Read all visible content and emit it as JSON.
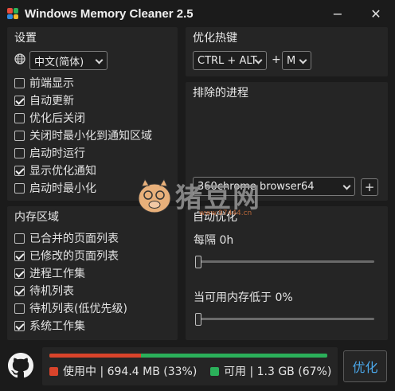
{
  "window": {
    "title": "Windows Memory Cleaner 2.5",
    "controls": {
      "minimize": "−",
      "close": "✕"
    },
    "icon_colors": [
      "#e84d3d",
      "#2fb45a",
      "#2f8be0",
      "#f1b82d"
    ]
  },
  "settings": {
    "title": "设置",
    "language_value": "中文(简体)",
    "options": [
      {
        "label": "前端显示",
        "checked": false
      },
      {
        "label": "自动更新",
        "checked": true
      },
      {
        "label": "优化后关闭",
        "checked": false
      },
      {
        "label": "关闭时最小化到通知区域",
        "checked": false
      },
      {
        "label": "启动时运行",
        "checked": false
      },
      {
        "label": "显示优化通知",
        "checked": true
      },
      {
        "label": "启动时最小化",
        "checked": false
      }
    ]
  },
  "hotkey": {
    "title": "优化热键",
    "modifier_value": "CTRL + ALT",
    "plus": "+",
    "key_value": "M"
  },
  "excluded": {
    "title": "排除的进程",
    "process_value": "360chrome browser64",
    "add_label": "+"
  },
  "memory_areas": {
    "title": "内存区域",
    "options": [
      {
        "label": "已合并的页面列表",
        "checked": false
      },
      {
        "label": "已修改的页面列表",
        "checked": true
      },
      {
        "label": "进程工作集",
        "checked": true
      },
      {
        "label": "待机列表",
        "checked": true
      },
      {
        "label": "待机列表(低优先级)",
        "checked": false
      },
      {
        "label": "系统工作集",
        "checked": true
      }
    ]
  },
  "auto_optimize": {
    "title": "自动优化",
    "interval_label": "每隔 0h",
    "interval_value": 0,
    "threshold_label": "当可用内存低于 0%",
    "threshold_value": 0
  },
  "memory": {
    "used_label": "使用中 | 694.4 MB (33%)",
    "free_label": "可用 | 1.3 GB (67%)",
    "used_fraction": 0.33,
    "used_color": "#d9442b",
    "free_color": "#2bb05a"
  },
  "optimize_button": "优化",
  "watermark": {
    "text": "猪豆网",
    "url": "www.97444.cn"
  }
}
